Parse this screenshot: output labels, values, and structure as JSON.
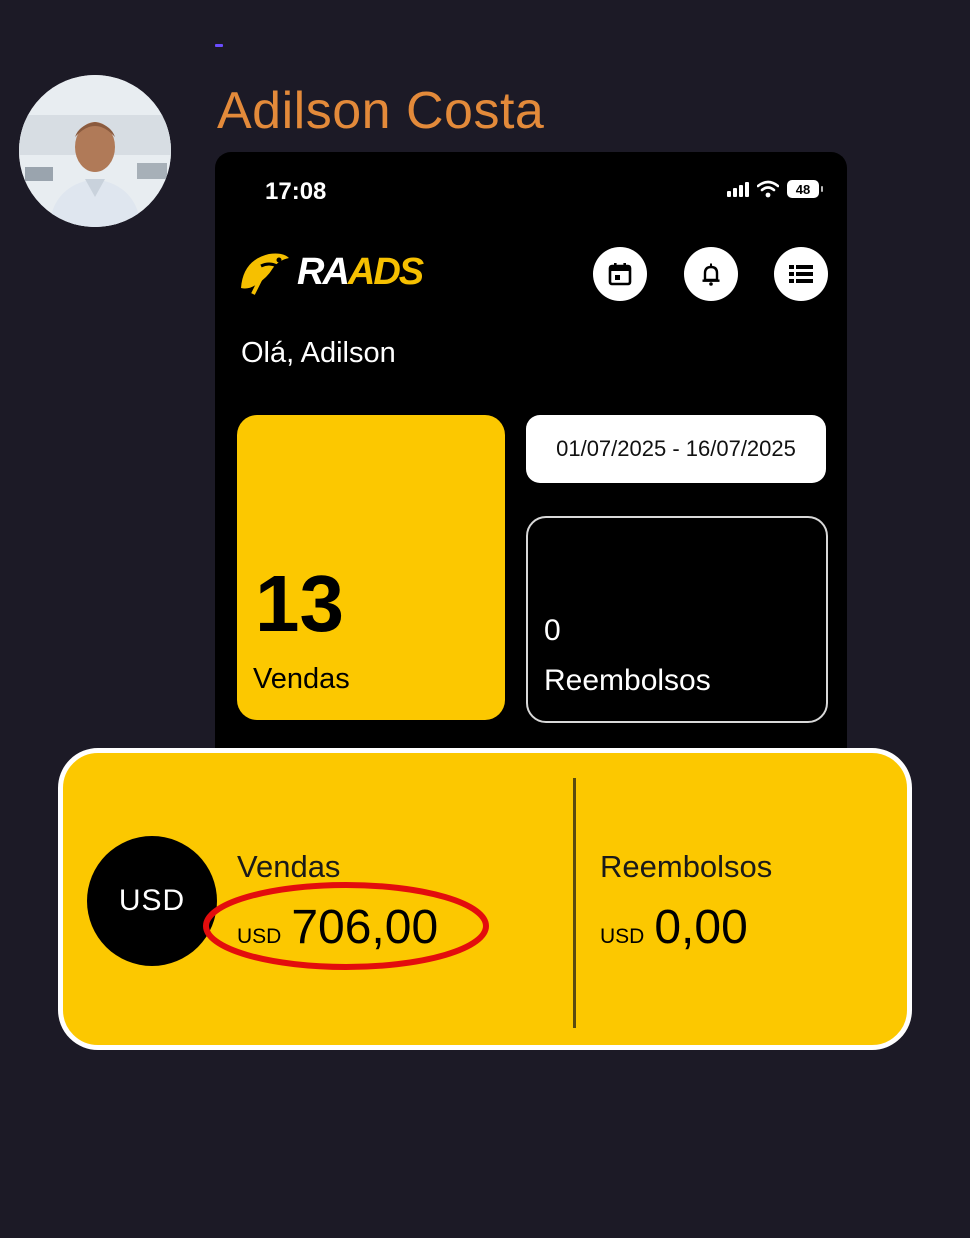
{
  "post": {
    "author_name": "Adilson Costa"
  },
  "phone": {
    "status_time": "17:08",
    "battery": "48",
    "brand": {
      "part1": "RA",
      "part2": "ADS"
    },
    "greeting": "Olá, Adilson",
    "date_range": "01/07/2025 - 16/07/2025",
    "sales_card": {
      "value": "13",
      "label": "Vendas"
    },
    "refunds_card": {
      "value": "0",
      "label": "Reembolsos"
    }
  },
  "summary": {
    "currency_badge": "USD",
    "sales": {
      "label": "Vendas",
      "currency": "USD",
      "amount": "706,00"
    },
    "refunds": {
      "label": "Reembolsos",
      "currency": "USD",
      "amount": "0,00"
    }
  },
  "colors": {
    "brand_yellow": "#fcc800",
    "author_orange": "#e38a3a",
    "highlight_red": "#e30d0d",
    "background": "#1c1a26"
  },
  "icons": [
    "calendar-icon",
    "bell-icon",
    "menu-list-icon",
    "wifi-icon",
    "signal-icon",
    "battery-icon",
    "logo-bird-icon"
  ]
}
